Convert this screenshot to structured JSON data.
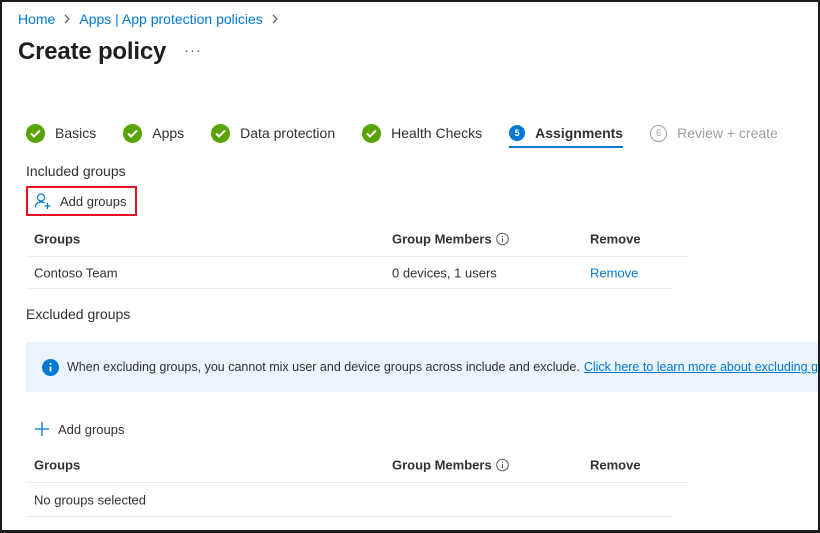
{
  "breadcrumb": {
    "items": [
      "Home",
      "Apps | App protection policies"
    ]
  },
  "page": {
    "title": "Create policy",
    "more_label": "···"
  },
  "steps": [
    {
      "label": "Basics",
      "state": "done"
    },
    {
      "label": "Apps",
      "state": "done"
    },
    {
      "label": "Data protection",
      "state": "done"
    },
    {
      "label": "Health Checks",
      "state": "done"
    },
    {
      "label": "Assignments",
      "number": "5",
      "state": "active"
    },
    {
      "label": "Review + create",
      "number": "6",
      "state": "disabled"
    }
  ],
  "included": {
    "label": "Included groups",
    "add_label": "Add groups",
    "columns": [
      "Groups",
      "Group Members",
      "Remove"
    ],
    "rows": [
      {
        "group": "Contoso Team",
        "members": "0 devices, 1 users",
        "remove": "Remove"
      }
    ]
  },
  "excluded": {
    "label": "Excluded groups",
    "banner_text": "When excluding groups, you cannot mix user and device groups across include and exclude.",
    "banner_link": "Click here to learn more about excluding groups.",
    "add_label": "Add groups",
    "columns": [
      "Groups",
      "Group Members",
      "Remove"
    ],
    "empty_text": "No groups selected"
  },
  "colors": {
    "accent": "#0078d4",
    "success": "#57a300",
    "highlight_border": "#e81123",
    "banner_bg": "#ebf3fc"
  }
}
